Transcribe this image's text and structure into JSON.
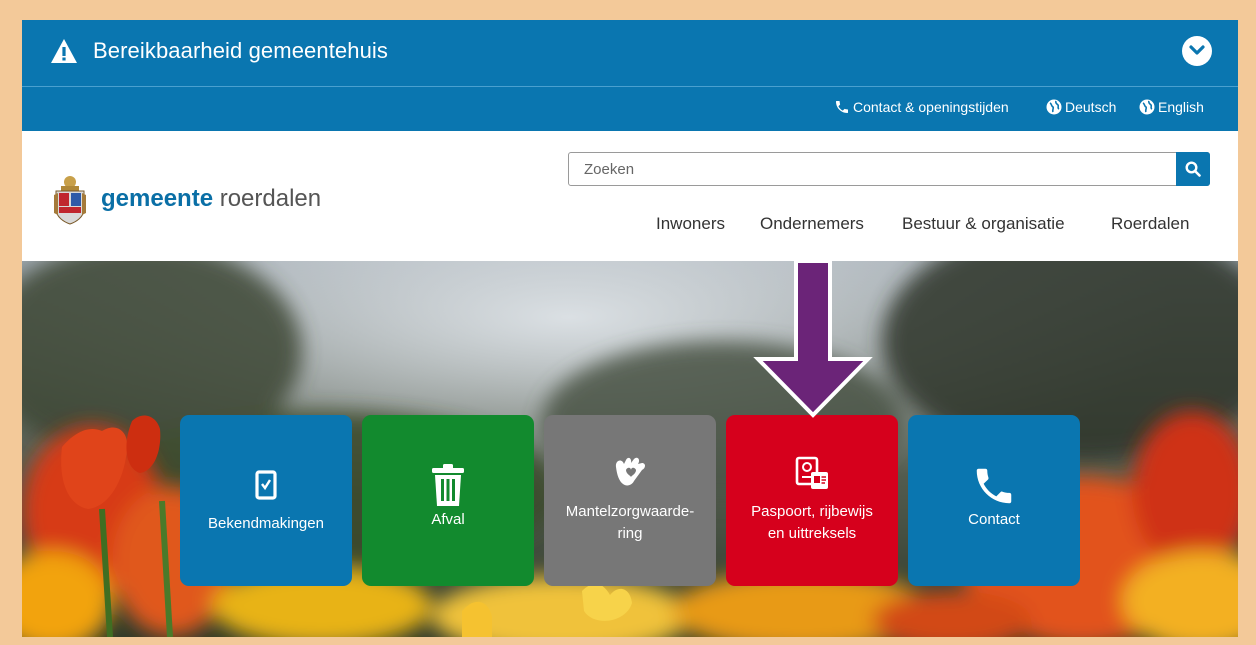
{
  "alert": {
    "title": "Bereikbaarheid gemeentehuis",
    "warning_icon": "warning-triangle-icon",
    "toggle_icon": "chevron-down-icon"
  },
  "utility_links": [
    {
      "label": "Contact & openingstijden",
      "icon": "phone-icon"
    },
    {
      "label": "Deutsch",
      "icon": "globe-icon"
    },
    {
      "label": "English",
      "icon": "globe-icon"
    }
  ],
  "logo": {
    "part1": "gemeente",
    "part2": "roerdalen",
    "crest_icon": "coat-of-arms-icon"
  },
  "search": {
    "placeholder": "Zoeken",
    "value": "",
    "button_icon": "search-icon"
  },
  "nav": [
    "Inwoners",
    "Ondernemers",
    "Bestuur & organisatie",
    "Roerdalen"
  ],
  "tiles": [
    {
      "label": "Bekendmakingen",
      "icon": "document-check-icon",
      "color": "#0a76b0"
    },
    {
      "label": "Afval",
      "icon": "trash-can-icon",
      "color": "#128a2e"
    },
    {
      "label": "Mantelzorgwaarde-\nring",
      "icon": "caring-hands-icon",
      "color": "#777777"
    },
    {
      "label": "Paspoort, rijbewijs\nen uittreksels",
      "icon": "passport-id-icon",
      "color": "#d6001c"
    },
    {
      "label": "Contact",
      "icon": "phone-icon",
      "color": "#0a76b0"
    }
  ],
  "colors": {
    "primary_blue": "#0a76b0",
    "header_bg": "#ffffff",
    "frame": "#f3c999",
    "annotation_arrow": "#6b2478"
  }
}
